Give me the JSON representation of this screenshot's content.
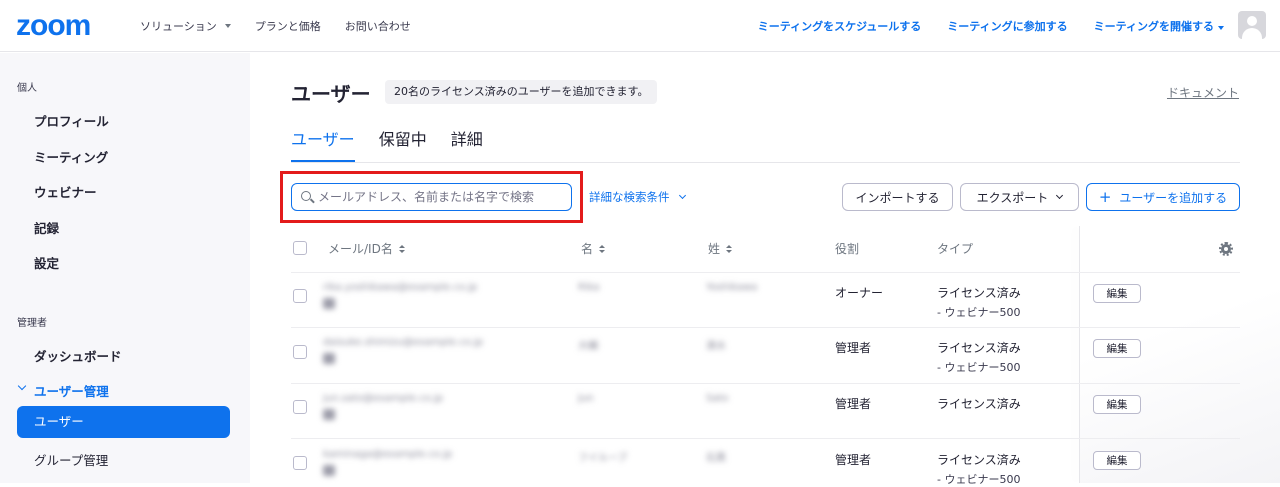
{
  "topnav": {
    "logo": "zoom",
    "left_items": [
      {
        "label": "ソリューション",
        "has_caret": true
      },
      {
        "label": "プランと価格",
        "has_caret": false
      },
      {
        "label": "お問い合わせ",
        "has_caret": false
      }
    ],
    "right_items": [
      {
        "label": "ミーティングをスケジュールする"
      },
      {
        "label": "ミーティングに参加する"
      },
      {
        "label": "ミーティングを開催する"
      }
    ],
    "avatar_icon": "user-avatar-icon"
  },
  "sidebar": {
    "personal_section": "個人",
    "personal_items": [
      "プロフィール",
      "ミーティング",
      "ウェビナー",
      "記録",
      "設定"
    ],
    "admin_section": "管理者",
    "admin_items": {
      "dashboard": "ダッシュボード",
      "user_management": "ユーザー管理",
      "users": "ユーザー",
      "group_management": "グループ管理"
    }
  },
  "main": {
    "title": "ユーザー",
    "license_badge": "20名のライセンス済みのユーザーを追加できます。",
    "doc_link": "ドキュメント",
    "tabs": [
      {
        "label": "ユーザー",
        "active": true
      },
      {
        "label": "保留中",
        "active": false
      },
      {
        "label": "詳細",
        "active": false
      }
    ],
    "search": {
      "placeholder": "メールアドレス、名前または名字で検索",
      "value": ""
    },
    "advanced_search": "詳細な検索条件",
    "buttons": {
      "import": "インポートする",
      "export": "エクスポート",
      "add_user": "ユーザーを追加する"
    },
    "table": {
      "headers": {
        "email": "メール/ID名",
        "first": "名",
        "last": "姓",
        "role": "役割",
        "type": "タイプ"
      },
      "rows": [
        {
          "email": "rika.yoshikawa@example.co.jp",
          "first": "Rika",
          "last": "Yoshikawa",
          "role": "オーナー",
          "type": "ライセンス済み",
          "sub": "- ウェビナー500"
        },
        {
          "email": "daisuke.shimizu@example.co.jp",
          "first": "大輔",
          "last": "清水",
          "role": "管理者",
          "type": "ライセンス済み",
          "sub": "- ウェビナー500"
        },
        {
          "email": "jun.sato@example.co.jp",
          "first": "Jun",
          "last": "Sato",
          "role": "管理者",
          "type": "ライセンス済み",
          "sub": ""
        },
        {
          "email": "kaminaga@example.co.jp",
          "first": "フイルーブ",
          "last": "石黒",
          "role": "管理者",
          "type": "ライセンス済み",
          "sub": "- ウェビナー500"
        }
      ],
      "edit_label": "編集"
    }
  }
}
